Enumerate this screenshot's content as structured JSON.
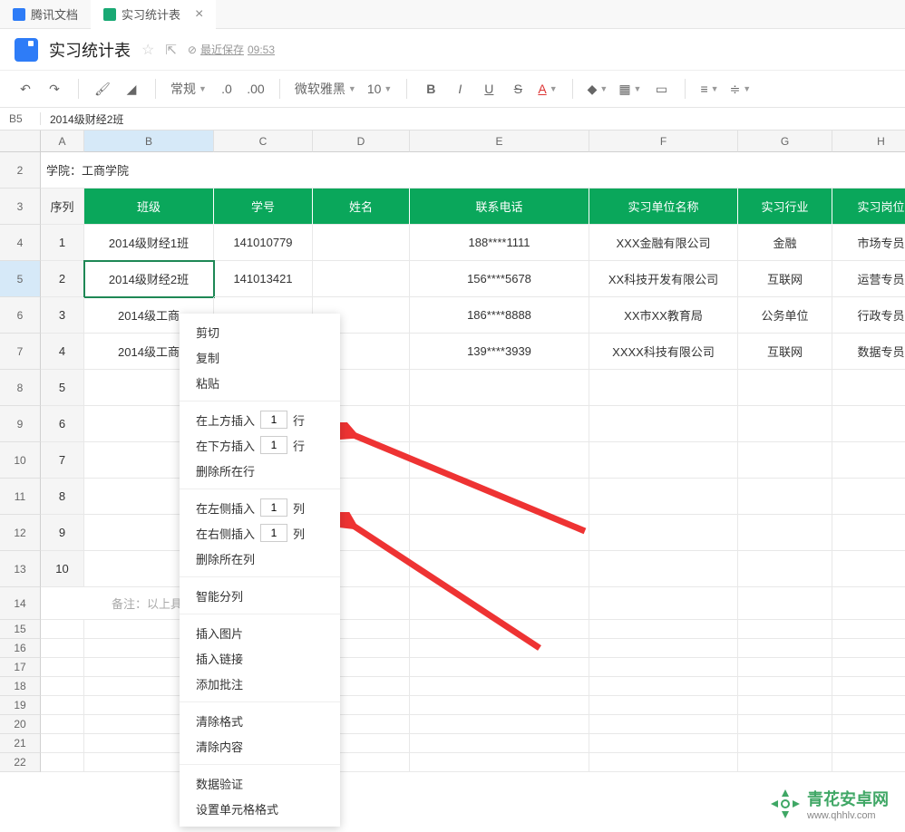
{
  "tabs": {
    "tab1": "腾讯文档",
    "tab2": "实习统计表"
  },
  "title": "实习统计表",
  "save_status": {
    "prefix": "最近保存",
    "time": "09:53"
  },
  "toolbar": {
    "style": "常规",
    "dec_minus": ".0",
    "dec_plus": ".00",
    "font": "微软雅黑",
    "size": "10"
  },
  "cell_ref": "B5",
  "formula_value": "2014级财经2班",
  "col_labels": [
    "A",
    "B",
    "C",
    "D",
    "E",
    "F",
    "G",
    "H"
  ],
  "row_labels": [
    "2",
    "3",
    "4",
    "5",
    "6",
    "7",
    "8",
    "9",
    "10",
    "11",
    "12",
    "13",
    "14",
    "15",
    "16",
    "17",
    "18",
    "19",
    "20",
    "21",
    "22"
  ],
  "cw": {
    "A": 48,
    "B": 143,
    "C": 109,
    "D": 107,
    "E": 198,
    "F": 164,
    "G": 104,
    "H": 108
  },
  "rh": {
    "head": 40,
    "data": 40,
    "small": 21,
    "mid": 36
  },
  "cells": {
    "a2": "学院：工商学院",
    "headers": {
      "A": "序列",
      "B": "班级",
      "C": "学号",
      "D": "姓名",
      "E": "联系电话",
      "F": "实习单位名称",
      "G": "实习行业",
      "H": "实习岗位"
    },
    "rows": [
      {
        "A": "1",
        "B": "2014级财经1班",
        "C": "141010779",
        "D": "",
        "E": "188****1111",
        "F": "XXX金融有限公司",
        "G": "金融",
        "H": "市场专员"
      },
      {
        "A": "2",
        "B": "2014级财经2班",
        "C": "141013421",
        "D": "",
        "E": "156****5678",
        "F": "XX科技开发有限公司",
        "G": "互联网",
        "H": "运营专员"
      },
      {
        "A": "3",
        "B": "2014级工商",
        "C": "",
        "D": "",
        "E": "186****8888",
        "F": "XX市XX教育局",
        "G": "公务单位",
        "H": "行政专员"
      },
      {
        "A": "4",
        "B": "2014级工商",
        "C": "",
        "D": "",
        "E": "139****3939",
        "F": "XXXX科技有限公司",
        "G": "互联网",
        "H": "数据专员"
      },
      {
        "A": "5"
      },
      {
        "A": "6"
      },
      {
        "A": "7"
      },
      {
        "A": "8"
      },
      {
        "A": "9"
      },
      {
        "A": "10"
      }
    ],
    "footnote": "备注：以上具体信"
  },
  "menu": {
    "cut": "剪切",
    "copy": "复制",
    "paste": "粘贴",
    "insert_above": "在上方插入",
    "insert_below": "在下方插入",
    "row_unit": "行",
    "delete_row": "删除所在行",
    "insert_left": "在左侧插入",
    "insert_right": "在右侧插入",
    "col_unit": "列",
    "delete_col": "删除所在列",
    "smart_split": "智能分列",
    "insert_image": "插入图片",
    "insert_link": "插入链接",
    "add_comment": "添加批注",
    "clear_format": "清除格式",
    "clear_content": "清除内容",
    "data_validation": "数据验证",
    "cell_format": "设置单元格格式",
    "default_count": "1"
  },
  "watermark": {
    "title": "青花安卓网",
    "url": "www.qhhlv.com"
  }
}
